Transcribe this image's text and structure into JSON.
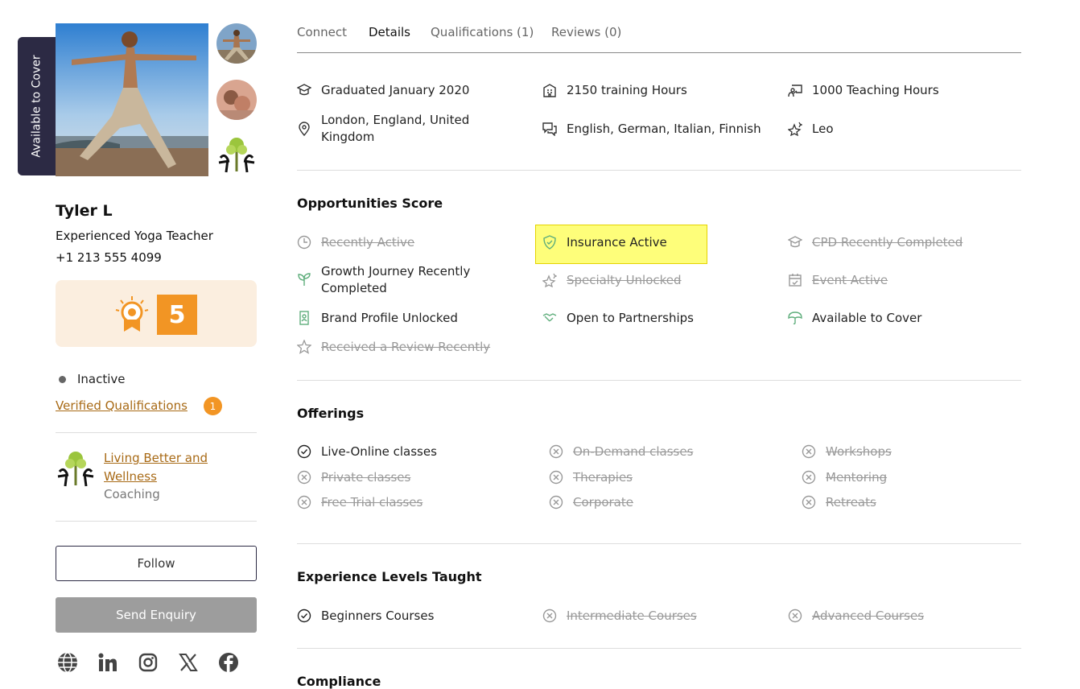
{
  "profile": {
    "cover_badge": "Available to Cover",
    "name": "Tyler L",
    "tagline": "Experienced Yoga Teacher",
    "phone": "+1 213 555 4099",
    "score": "5",
    "status": "Inactive",
    "verified_link": "Verified Qualifications",
    "verified_count": "1",
    "studio_name": "Living Better and Wellness",
    "studio_type": "Coaching",
    "follow_label": "Follow",
    "enquiry_label": "Send Enquiry",
    "socials": [
      "globe-icon",
      "linkedin-icon",
      "instagram-icon",
      "x-icon",
      "facebook-icon"
    ]
  },
  "tabs": [
    "Connect",
    "Details",
    "Qualifications (1)",
    "Reviews (0)"
  ],
  "active_tab": "Details",
  "details": [
    {
      "icon": "graduation-cap-icon",
      "text": "Graduated January 2020"
    },
    {
      "icon": "building-icon",
      "text": "2150 training Hours"
    },
    {
      "icon": "teacher-board-icon",
      "text": "1000 Teaching Hours"
    },
    {
      "icon": "location-pin-icon",
      "text": "London, England, United Kingdom"
    },
    {
      "icon": "chat-bubbles-icon",
      "text": "English, German, Italian, Finnish"
    },
    {
      "icon": "star-sparkle-icon",
      "text": "Leo"
    }
  ],
  "opportunities": {
    "title": "Opportunities Score",
    "items": [
      {
        "text": "Recently Active",
        "active": false,
        "icon": "clock-icon"
      },
      {
        "text": "Insurance Active",
        "active": true,
        "icon": "shield-icon",
        "highlighted": true
      },
      {
        "text": "CPD Recently Completed",
        "active": false,
        "icon": "graduation-cap-icon"
      },
      {
        "text": "Growth Journey Recently Completed",
        "active": true,
        "icon": "sprout-icon"
      },
      {
        "text": "Specialty Unlocked",
        "active": false,
        "icon": "star-sparkle-icon"
      },
      {
        "text": "Event Active",
        "active": false,
        "icon": "calendar-icon"
      },
      {
        "text": "Brand Profile Unlocked",
        "active": true,
        "icon": "badge-card-icon"
      },
      {
        "text": "Open to Partnerships",
        "active": true,
        "icon": "handshake-icon"
      },
      {
        "text": "Available to Cover",
        "active": true,
        "icon": "umbrella-icon"
      },
      {
        "text": "Received a Review Recently",
        "active": false,
        "icon": "star-icon"
      }
    ]
  },
  "offerings": {
    "title": "Offerings",
    "items": [
      {
        "text": "Live-Online classes",
        "active": true
      },
      {
        "text": "On-Demand classes",
        "active": false
      },
      {
        "text": "Workshops",
        "active": false
      },
      {
        "text": "Private classes",
        "active": false
      },
      {
        "text": "Therapies",
        "active": false
      },
      {
        "text": "Mentoring",
        "active": false
      },
      {
        "text": "Free Trial classes",
        "active": false
      },
      {
        "text": "Corporate",
        "active": false
      },
      {
        "text": "Retreats",
        "active": false
      }
    ]
  },
  "experience": {
    "title": "Experience Levels Taught",
    "items": [
      {
        "text": "Beginners Courses",
        "active": true
      },
      {
        "text": "Intermediate Courses",
        "active": false
      },
      {
        "text": "Advanced Courses",
        "active": false
      }
    ]
  },
  "compliance": {
    "title": "Compliance"
  },
  "colors": {
    "accent": "#f29524",
    "link": "#a86a16",
    "dark": "#2c2a44",
    "green_icon": "#5fae7c"
  }
}
